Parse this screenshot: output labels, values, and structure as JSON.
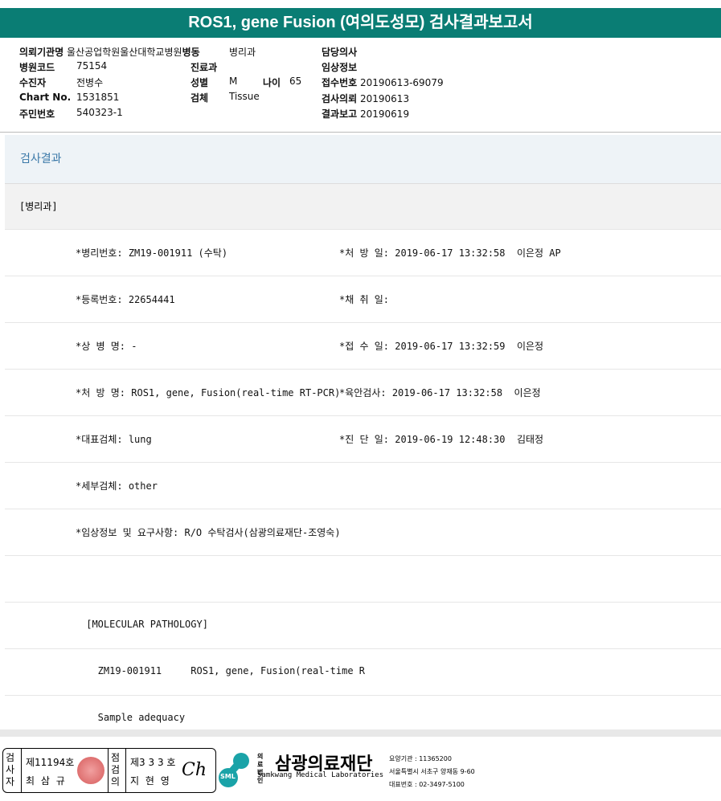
{
  "title": "ROS1, gene Fusion (여의도성모) 검사결과보고서",
  "info": {
    "inst_label": "의뢰기관명",
    "inst": "울산공업학원울산대학교병원",
    "ward_label": "병동",
    "ward": "병리과",
    "doctor_label": "담당의사",
    "code_label": "병원코드",
    "code": "75154",
    "dept_label": "진료과",
    "clinical_label": "임상정보",
    "patient_label": "수진자",
    "patient": "전병수",
    "sex_label": "성별",
    "sex": "M",
    "age_label": "나이",
    "age": "65",
    "accession_label": "접수번호",
    "accession": "20190613-69079",
    "chart_label": "Chart No.",
    "chart": "1531851",
    "specimen_label": "검체",
    "specimen": "Tissue",
    "request_label": "검사의뢰",
    "request": "20190613",
    "id_label": "주민번호",
    "id": "540323-1",
    "report_label": "결과보고",
    "report": "20190619"
  },
  "section": "검사결과",
  "dept": "[병리과]",
  "rows": [
    {
      "left": "*병리번호: ZM19-001911 (수탁)",
      "right": "*처 방 일: 2019-06-17 13:32:58  이은정 AP"
    },
    {
      "left": "*등록번호: 22654441",
      "right": "*채 취 일:"
    },
    {
      "left": "*상 병 명: -",
      "right": "*접 수 일: 2019-06-17 13:32:59  이은정"
    },
    {
      "left": "*처 방 명: ROS1, gene, Fusion(real-time RT-PCR)",
      "right": "*육안검사: 2019-06-17 13:32:58  이은정"
    },
    {
      "left": "*대표검체: lung",
      "right": "*진 단 일: 2019-06-19 12:48:30  김태정"
    },
    {
      "left": "*세부검체: other",
      "right": ""
    },
    {
      "left": "*임상정보 및 요구사항: R/O 수탁검사(삼광의료재단-조영숙)",
      "right": ""
    },
    {
      "left": "",
      "right": ""
    },
    {
      "left": " [MOLECULAR PATHOLOGY]",
      "right": ""
    },
    {
      "left": "   ZM19-001911     ROS1, gene, Fusion(real-time R",
      "right": ""
    },
    {
      "left": "   Sample adequacy",
      "right": ""
    }
  ],
  "footer": {
    "examiner_label": "검사자",
    "examiner_no": "제11194호",
    "examiner": "최 삼 규",
    "checker_label": "점검의",
    "checker_no": "제3 3 3 호",
    "checker": "지 현 영",
    "logo_small1": "의료",
    "logo_small2": "법인",
    "logo_name": "삼광의료재단",
    "logo_en": "Samkwang Medical Laboratories",
    "logo_badge": "SML",
    "inst_code": "요양기관 : 11365200",
    "address": "서울특별시 서초구 양재동 9-60",
    "phone": "대표번호 : 02-3497-5100"
  }
}
